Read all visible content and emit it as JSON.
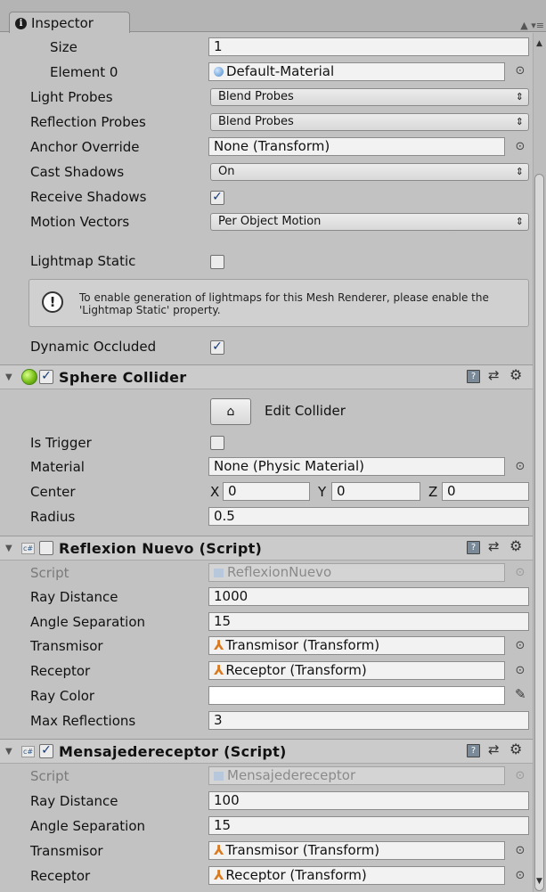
{
  "window": {
    "tab_title": "Inspector",
    "tab_menu": "▲ ▾≡"
  },
  "mesh_renderer": {
    "size_label": "Size",
    "size_value": "1",
    "element0_label": "Element 0",
    "element0_value": "Default-Material",
    "light_probes_label": "Light Probes",
    "light_probes_value": "Blend Probes",
    "reflection_probes_label": "Reflection Probes",
    "reflection_probes_value": "Blend Probes",
    "anchor_override_label": "Anchor Override",
    "anchor_override_value": "None (Transform)",
    "cast_shadows_label": "Cast Shadows",
    "cast_shadows_value": "On",
    "receive_shadows_label": "Receive Shadows",
    "receive_shadows_checked": true,
    "motion_vectors_label": "Motion Vectors",
    "motion_vectors_value": "Per Object Motion",
    "lightmap_static_label": "Lightmap Static",
    "lightmap_static_checked": false,
    "help_text": "To enable generation of lightmaps for this Mesh Renderer, please enable the 'Lightmap Static' property.",
    "dynamic_occluded_label": "Dynamic Occluded",
    "dynamic_occluded_checked": true
  },
  "sphere_collider": {
    "title": "Sphere Collider",
    "enabled": true,
    "edit_collider_label": "Edit Collider",
    "is_trigger_label": "Is Trigger",
    "is_trigger_checked": false,
    "material_label": "Material",
    "material_value": "None (Physic Material)",
    "center_label": "Center",
    "center_x_label": "X",
    "center_x": "0",
    "center_y_label": "Y",
    "center_y": "0",
    "center_z_label": "Z",
    "center_z": "0",
    "radius_label": "Radius",
    "radius_value": "0.5"
  },
  "reflexion_nuevo": {
    "title": "Reflexion Nuevo (Script)",
    "enabled": false,
    "script_label": "Script",
    "script_value": "ReflexionNuevo",
    "ray_distance_label": "Ray Distance",
    "ray_distance_value": "1000",
    "angle_separation_label": "Angle Separation",
    "angle_separation_value": "15",
    "transmisor_label": "Transmisor",
    "transmisor_value": "Transmisor (Transform)",
    "receptor_label": "Receptor",
    "receptor_value": "Receptor (Transform)",
    "ray_color_label": "Ray Color",
    "ray_color_value": "#ffffff",
    "max_reflections_label": "Max Reflections",
    "max_reflections_value": "3"
  },
  "mensajedereceptor": {
    "title": "Mensajedereceptor (Script)",
    "enabled": true,
    "script_label": "Script",
    "script_value": "Mensajedereceptor",
    "ray_distance_label": "Ray Distance",
    "ray_distance_value": "100",
    "angle_separation_label": "Angle Separation",
    "angle_separation_value": "15",
    "transmisor_label": "Transmisor",
    "transmisor_value": "Transmisor (Transform)",
    "receptor_label": "Receptor",
    "receptor_value": "Receptor (Transform)"
  },
  "colors": {
    "background": "#c2c2c2",
    "header": "#cbcbcb",
    "check": "#143a7a",
    "transform_icon": "#d97a20"
  }
}
